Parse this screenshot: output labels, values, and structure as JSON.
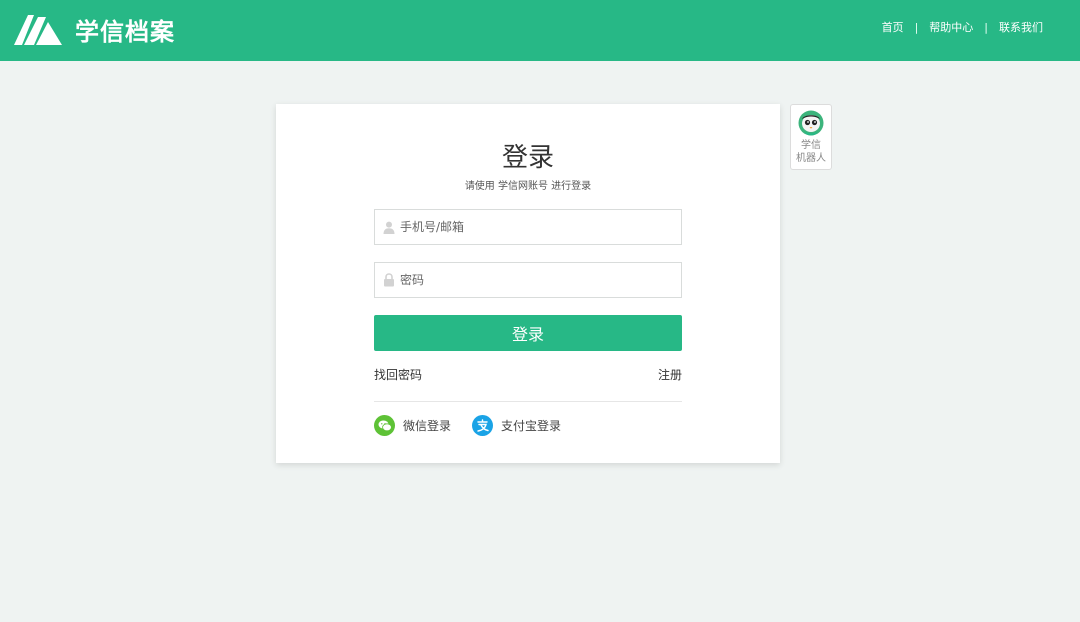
{
  "header": {
    "logo_text": "学信档案",
    "nav": {
      "home": "首页",
      "help": "帮助中心",
      "contact": "联系我们",
      "separator": "|"
    }
  },
  "login": {
    "title": "登录",
    "subtitle": "请使用 学信网账号 进行登录",
    "username_placeholder": "手机号/邮箱",
    "password_placeholder": "密码",
    "submit_label": "登录",
    "forgot_password": "找回密码",
    "register": "注册",
    "wechat_login": "微信登录",
    "alipay_login": "支付宝登录"
  },
  "robot": {
    "label_line1": "学信",
    "label_line2": "机器人"
  },
  "colors": {
    "brand": "#27b886",
    "wechat": "#5ec236",
    "alipay": "#1aa3e6"
  }
}
